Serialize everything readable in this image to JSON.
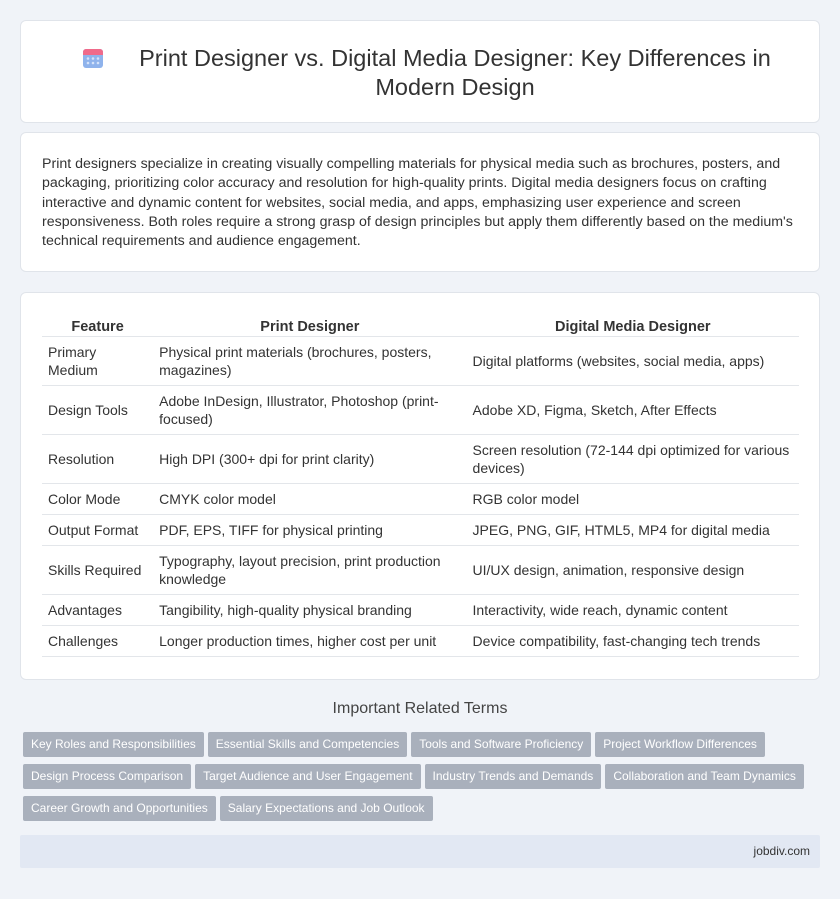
{
  "header": {
    "title": "Print Designer vs. Digital Media Designer: Key Differences in Modern Design",
    "icon": "calendar-icon"
  },
  "intro": {
    "text": "Print designers specialize in creating visually compelling materials for physical media such as brochures, posters, and packaging, prioritizing color accuracy and resolution for high-quality prints. Digital media designers focus on crafting interactive and dynamic content for websites, social media, and apps, emphasizing user experience and screen responsiveness. Both roles require a strong grasp of design principles but apply them differently based on the medium's technical requirements and audience engagement."
  },
  "table": {
    "headers": [
      "Feature",
      "Print Designer",
      "Digital Media Designer"
    ],
    "rows": [
      [
        "Primary Medium",
        "Physical print materials (brochures, posters, magazines)",
        "Digital platforms (websites, social media, apps)"
      ],
      [
        "Design Tools",
        "Adobe InDesign, Illustrator, Photoshop (print-focused)",
        "Adobe XD, Figma, Sketch, After Effects"
      ],
      [
        "Resolution",
        "High DPI (300+ dpi for print clarity)",
        "Screen resolution (72-144 dpi optimized for various devices)"
      ],
      [
        "Color Mode",
        "CMYK color model",
        "RGB color model"
      ],
      [
        "Output Format",
        "PDF, EPS, TIFF for physical printing",
        "JPEG, PNG, GIF, HTML5, MP4 for digital media"
      ],
      [
        "Skills Required",
        "Typography, layout precision, print production knowledge",
        "UI/UX design, animation, responsive design"
      ],
      [
        "Advantages",
        "Tangibility, high-quality physical branding",
        "Interactivity, wide reach, dynamic content"
      ],
      [
        "Challenges",
        "Longer production times, higher cost per unit",
        "Device compatibility, fast-changing tech trends"
      ]
    ]
  },
  "related": {
    "title": "Important Related Terms",
    "tags": [
      "Key Roles and Responsibilities",
      "Essential Skills and Competencies",
      "Tools and Software Proficiency",
      "Project Workflow Differences",
      "Design Process Comparison",
      "Target Audience and User Engagement",
      "Industry Trends and Demands",
      "Collaboration and Team Dynamics",
      "Career Growth and Opportunities",
      "Salary Expectations and Job Outlook"
    ]
  },
  "footer": {
    "text": "jobdiv.com"
  },
  "colors": {
    "page_bg": "#f0f3f8",
    "tag_bg": "#a9b0bc",
    "footer_bg": "#e2e8f3",
    "icon_top": "#f06a8a",
    "icon_body": "#7aa5e8"
  }
}
